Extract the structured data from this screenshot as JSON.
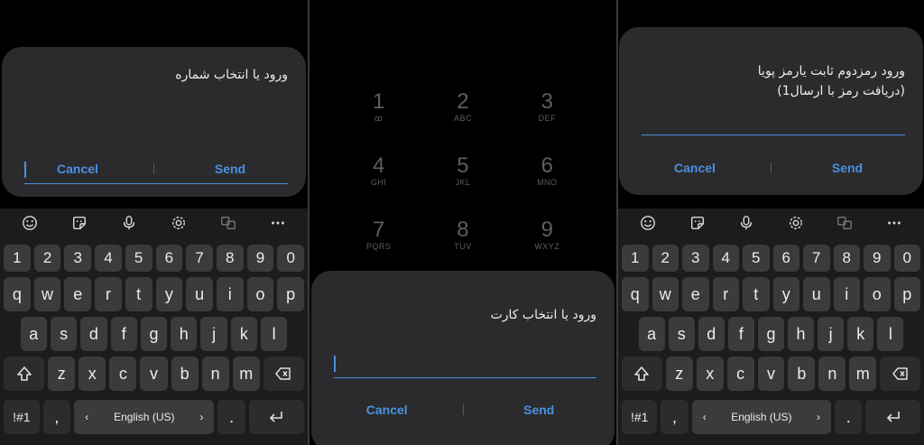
{
  "colors": {
    "accent": "#4a90e2",
    "dialog_bg": "#2b2b2d",
    "key_bg": "#3b3b3d",
    "kb_bg": "#1c1c1e"
  },
  "panel1": {
    "dialog": {
      "title": "ورود یا انتخاب شماره",
      "cancel": "Cancel",
      "send": "Send"
    },
    "keyboard": {
      "toolbar": [
        "emoji-icon",
        "sticker-icon",
        "mic-icon",
        "settings-icon",
        "translate-icon",
        "more-icon"
      ],
      "numbers": [
        "1",
        "2",
        "3",
        "4",
        "5",
        "6",
        "7",
        "8",
        "9",
        "0"
      ],
      "row1": [
        "q",
        "w",
        "e",
        "r",
        "t",
        "y",
        "u",
        "i",
        "o",
        "p"
      ],
      "row2": [
        "a",
        "s",
        "d",
        "f",
        "g",
        "h",
        "j",
        "k",
        "l"
      ],
      "row3": [
        "z",
        "x",
        "c",
        "v",
        "b",
        "n",
        "m"
      ],
      "symbols": "!#1",
      "comma": ",",
      "space": "English (US)",
      "period": "."
    }
  },
  "panel2": {
    "dialpad": [
      [
        {
          "d": "1",
          "s": "ꝏ"
        },
        {
          "d": "2",
          "s": "ABC"
        },
        {
          "d": "3",
          "s": "DEF"
        }
      ],
      [
        {
          "d": "4",
          "s": "GHI"
        },
        {
          "d": "5",
          "s": "JKL"
        },
        {
          "d": "6",
          "s": "MNO"
        }
      ],
      [
        {
          "d": "7",
          "s": "PQRS"
        },
        {
          "d": "8",
          "s": "TUV"
        },
        {
          "d": "9",
          "s": "WXYZ"
        }
      ]
    ],
    "dialog": {
      "title": "ورود یا انتخاب کارت",
      "cancel": "Cancel",
      "send": "Send"
    }
  },
  "panel3": {
    "dialog": {
      "title_line1": "ورود رمزدوم ثابت یارمز پویا",
      "title_line2": "(دریافت رمز با ارسال1)",
      "cancel": "Cancel",
      "send": "Send"
    },
    "keyboard": {
      "numbers": [
        "1",
        "2",
        "3",
        "4",
        "5",
        "6",
        "7",
        "8",
        "9",
        "0"
      ],
      "row1": [
        "q",
        "w",
        "e",
        "r",
        "t",
        "y",
        "u",
        "i",
        "o",
        "p"
      ],
      "row2": [
        "a",
        "s",
        "d",
        "f",
        "g",
        "h",
        "j",
        "k",
        "l"
      ],
      "row3": [
        "z",
        "x",
        "c",
        "v",
        "b",
        "n",
        "m"
      ],
      "symbols": "!#1",
      "comma": ",",
      "space": "English (US)",
      "period": "."
    }
  }
}
